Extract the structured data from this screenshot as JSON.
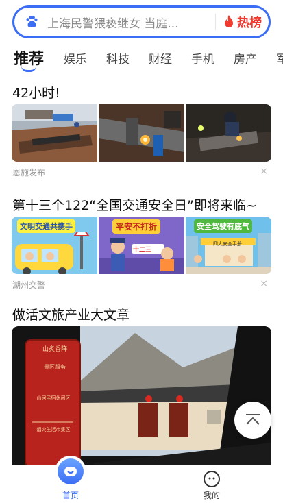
{
  "search": {
    "query": "上海民警猥亵继女 当庭...",
    "hot_label": "热榜"
  },
  "tabs": [
    "推荐",
    "娱乐",
    "科技",
    "财经",
    "手机",
    "房产",
    "军"
  ],
  "articles": [
    {
      "title": "42小时!",
      "source": "恩施发布",
      "close": "×"
    },
    {
      "title": "第十三个122“全国交通安全日”即将来临~",
      "source": "湖州交警",
      "close": "×",
      "banner_texts": [
        "文明交通共携手",
        "平安不打折",
        "安全驾驶有底气"
      ],
      "banner_subtexts": [
        "",
        "十二三",
        "四大安全手册"
      ]
    },
    {
      "title": "做活文旅产业大文章",
      "image_texts": [
        "山炙香阵",
        "景区服务",
        "山居民宿休闲区",
        "烟火生活市集区"
      ]
    }
  ],
  "bottom_nav": {
    "home": "首页",
    "mine": "我的"
  },
  "colors": {
    "accent": "#3b6ef5",
    "hot": "#f23a2f"
  }
}
